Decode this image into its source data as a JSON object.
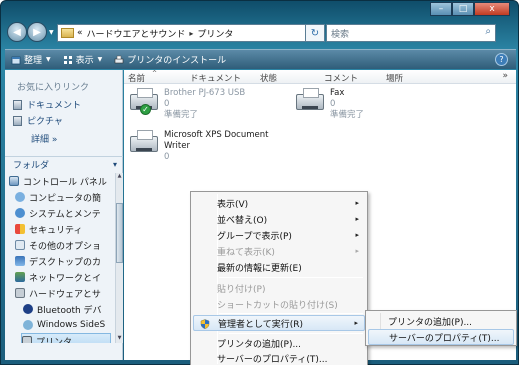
{
  "window": {
    "caption": {
      "minimize": "–",
      "maximize": "□",
      "close": "x"
    }
  },
  "address": {
    "prefix": "«",
    "segments": [
      "ハードウエアとサウンド",
      "プリンタ"
    ],
    "separator": "▸",
    "dropdown": "▾",
    "refresh_icon": "refresh-icon"
  },
  "search": {
    "placeholder": "検索",
    "icon": "search-icon"
  },
  "toolbar": {
    "organize": "整理",
    "views": "表示",
    "install_printer": "プリンタのインストール",
    "help": "?"
  },
  "left_pane": {
    "favorites_title": "お気に入りリンク",
    "favorites": [
      "ドキュメント",
      "ピクチャ"
    ],
    "details": "詳細 »",
    "folders_title": "フォルダ",
    "tree": [
      "コントロール パネル",
      "コンピュータの簡",
      "システムとメンテ",
      "セキュリティ",
      "その他のオプショ",
      "デスクトップのカ",
      "ネットワークとイ",
      "ハードウェアとサ",
      "Bluetooth デバ",
      "Windows SideS",
      "プリンタ"
    ]
  },
  "columns": {
    "name": "名前",
    "documents": "ドキュメント",
    "status": "状態",
    "comment": "コメント",
    "location": "場所",
    "more": "»"
  },
  "printers": [
    {
      "name": "Brother PJ-673 USB",
      "docs": "0",
      "status": "準備完了",
      "default": true
    },
    {
      "name": "Fax",
      "docs": "0",
      "status": "準備完了",
      "default": false
    },
    {
      "name": "Microsoft XPS Document Writer",
      "name_line1": "Microsoft XPS Document",
      "name_line2": "Writer",
      "docs": "0",
      "status": "",
      "default": false
    }
  ],
  "context_menu": {
    "items": [
      {
        "label": "表示(V)",
        "submenu": true,
        "disabled": false
      },
      {
        "label": "並べ替え(O)",
        "submenu": true,
        "disabled": false
      },
      {
        "label": "グループで表示(P)",
        "submenu": true,
        "disabled": false
      },
      {
        "label": "重ねて表示(K)",
        "submenu": true,
        "disabled": true
      },
      {
        "label": "最新の情報に更新(E)",
        "submenu": false,
        "disabled": false
      },
      {
        "label": "貼り付け(P)",
        "submenu": false,
        "disabled": true
      },
      {
        "label": "ショートカットの貼り付け(S)",
        "submenu": false,
        "disabled": true
      },
      {
        "label": "管理者として実行(R)",
        "submenu": true,
        "disabled": false,
        "highlighted": true,
        "icon": "uac-shield-icon"
      },
      {
        "label": "プリンタの追加(P)...",
        "submenu": false,
        "disabled": false
      },
      {
        "label": "サーバーのプロパティ(T)...",
        "submenu": false,
        "disabled": false
      }
    ],
    "submenu_arrow": "▸"
  },
  "sub_menu": {
    "items": [
      {
        "label": "プリンタの追加(P)...",
        "highlighted": false
      },
      {
        "label": "サーバーのプロパティ(T)...",
        "highlighted": true
      }
    ]
  }
}
